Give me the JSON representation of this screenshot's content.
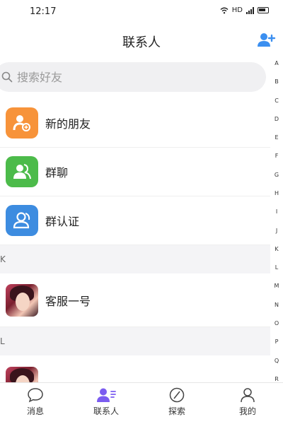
{
  "status": {
    "time": "12:17",
    "network": "HD"
  },
  "header": {
    "title": "联系人"
  },
  "search": {
    "placeholder": "搜索好友"
  },
  "quick_items": [
    {
      "label": "新的朋友",
      "icon": "new-friend-icon",
      "color": "#f7933a"
    },
    {
      "label": "群聊",
      "icon": "group-chat-icon",
      "color": "#4cbb4a"
    },
    {
      "label": "群认证",
      "icon": "group-verify-icon",
      "color": "#3d8ce0"
    }
  ],
  "contacts": [
    {
      "section": "K",
      "name": "客服一号"
    },
    {
      "section": "L",
      "name": ""
    }
  ],
  "index_letters": [
    "A",
    "B",
    "C",
    "D",
    "E",
    "F",
    "G",
    "H",
    "I",
    "J",
    "K",
    "L",
    "M",
    "N",
    "O",
    "P",
    "Q",
    "R"
  ],
  "tabs": [
    {
      "label": "消息",
      "icon": "message-icon"
    },
    {
      "label": "联系人",
      "icon": "contacts-icon",
      "active": true,
      "accent": "#7b5cf0"
    },
    {
      "label": "探索",
      "icon": "explore-icon"
    },
    {
      "label": "我的",
      "icon": "profile-icon"
    }
  ]
}
